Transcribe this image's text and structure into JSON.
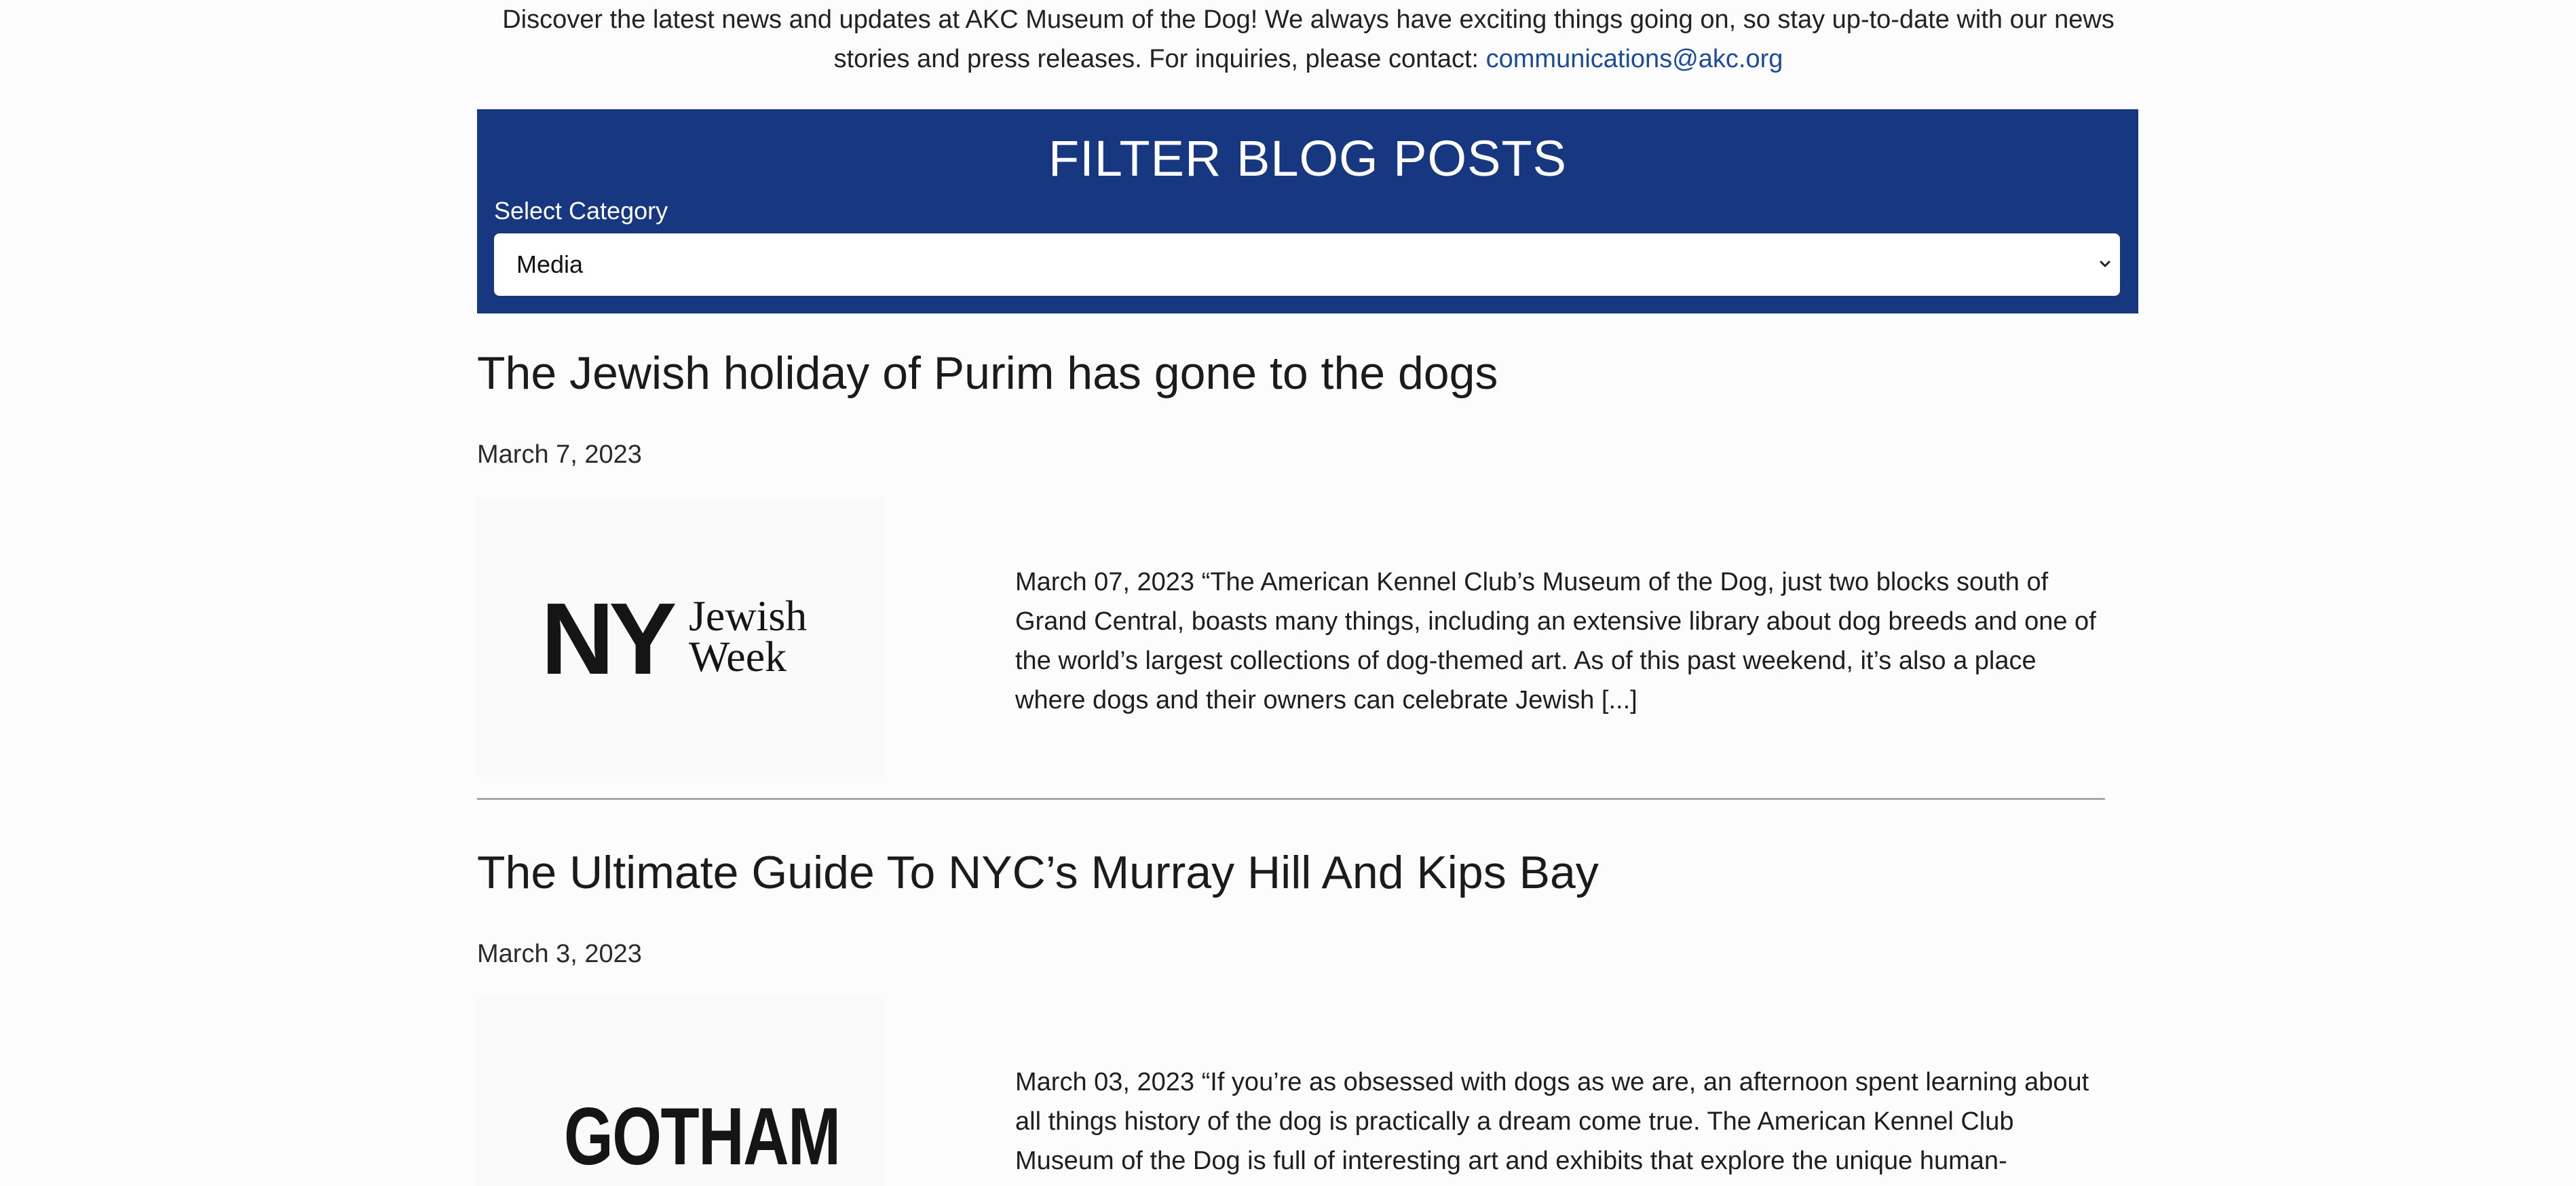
{
  "intro": {
    "line1": "Discover the latest news and updates at AKC Museum of the Dog! We always have exciting things going on, so stay up-to-date with our news",
    "line2": "stories and press releases. For inquiries, please contact: ",
    "email": "communications@akc.org"
  },
  "filter": {
    "title": "FILTER BLOG POSTS",
    "label": "Select Category",
    "selected": "Media",
    "chevron_icon": "chevron-down-icon"
  },
  "posts": [
    {
      "title": "The Jewish holiday of Purim has gone to the dogs",
      "date": "March 7, 2023",
      "logo_top": "NY",
      "logo_line1": "Jewish",
      "logo_line2": "Week",
      "excerpt": "March 07, 2023 “The American Kennel Club’s Museum of the Dog, just two blocks south of Grand Central, boasts many things, including an extensive library about dog breeds and one of the world’s largest collections of dog-themed art. As of this past weekend, it’s also a place where dogs and their owners can celebrate Jewish [...]"
    },
    {
      "title": "The Ultimate Guide To NYC’s Murray Hill And Kips Bay",
      "date": "March 3, 2023",
      "logo_top": "GOTHAM",
      "excerpt": "March 03, 2023 “If you’re as obsessed with dogs as we are, an afternoon spent learning about all things history of the dog is practically a dream come true. The American Kennel Club Museum of the Dog is full of interesting art and exhibits that explore the unique human-"
    }
  ]
}
